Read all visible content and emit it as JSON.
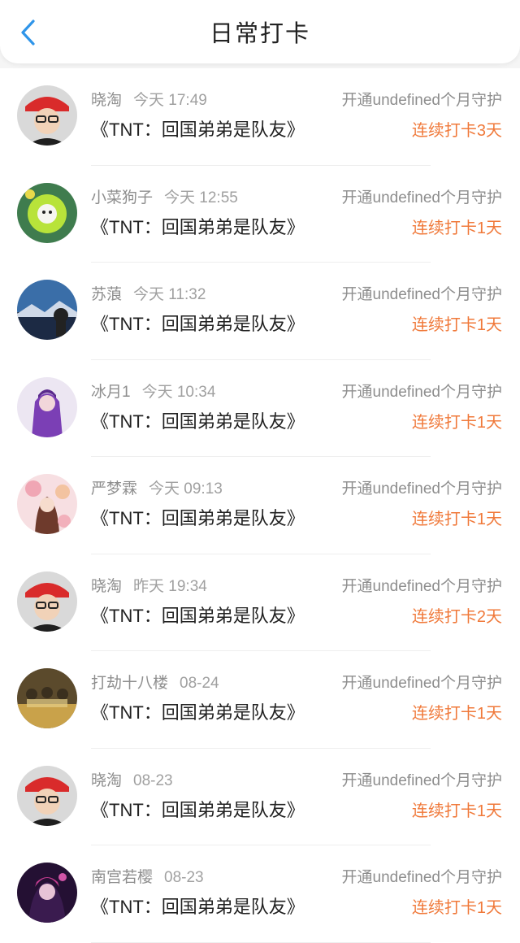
{
  "header": {
    "title": "日常打卡",
    "back_icon": "chevron-left-icon",
    "accent": "#2f95e9"
  },
  "colors": {
    "streak": "#f0793a"
  },
  "entries": [
    {
      "user": "晓淘",
      "time": "今天 17:49",
      "guard": "开通undefined个月守护",
      "book": "《TNT：回国弟弟是队友》",
      "streak": "连续打卡3天"
    },
    {
      "user": "小菜狗子",
      "time": "今天 12:55",
      "guard": "开通undefined个月守护",
      "book": "《TNT：回国弟弟是队友》",
      "streak": "连续打卡1天"
    },
    {
      "user": "苏蒗",
      "time": "今天 11:32",
      "guard": "开通undefined个月守护",
      "book": "《TNT：回国弟弟是队友》",
      "streak": "连续打卡1天"
    },
    {
      "user": "冰月1",
      "time": "今天 10:34",
      "guard": "开通undefined个月守护",
      "book": "《TNT：回国弟弟是队友》",
      "streak": "连续打卡1天"
    },
    {
      "user": "严梦霖",
      "time": "今天 09:13",
      "guard": "开通undefined个月守护",
      "book": "《TNT：回国弟弟是队友》",
      "streak": "连续打卡1天"
    },
    {
      "user": "晓淘",
      "time": "昨天 19:34",
      "guard": "开通undefined个月守护",
      "book": "《TNT：回国弟弟是队友》",
      "streak": "连续打卡2天"
    },
    {
      "user": "打劫十八楼",
      "time": "08-24",
      "guard": "开通undefined个月守护",
      "book": "《TNT：回国弟弟是队友》",
      "streak": "连续打卡1天"
    },
    {
      "user": "晓淘",
      "time": "08-23",
      "guard": "开通undefined个月守护",
      "book": "《TNT：回国弟弟是队友》",
      "streak": "连续打卡1天"
    },
    {
      "user": "南宫若樱",
      "time": "08-23",
      "guard": "开通undefined个月守护",
      "book": "《TNT：回国弟弟是队友》",
      "streak": "连续打卡1天"
    }
  ]
}
